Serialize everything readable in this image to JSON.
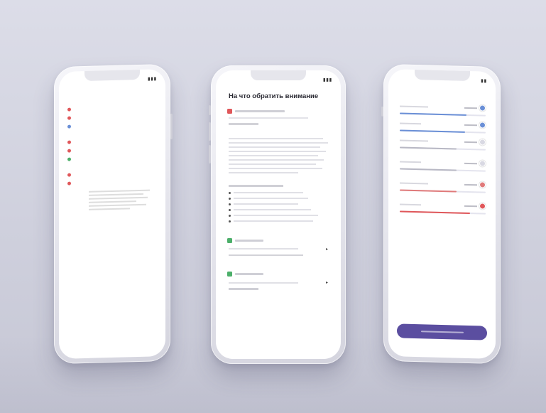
{
  "colors": {
    "background": "#d3d4e0",
    "accent_purple": "#5b4ea0",
    "red": "#e0575a",
    "green": "#4caf6a",
    "blue": "#6a8fd6"
  },
  "left_phone": {
    "status_time": "",
    "title": "",
    "sections": [
      {
        "heading": "",
        "rows": [
          {
            "color": "#e0575a",
            "tag": "",
            "text": ""
          },
          {
            "color": "#e0575a",
            "tag": "",
            "text": ""
          },
          {
            "color": "#6a8fd6",
            "tag": "",
            "text": ""
          }
        ]
      },
      {
        "heading": "",
        "rows": [
          {
            "color": "#e0575a",
            "tag": "",
            "text": ""
          },
          {
            "color": "#e0575a",
            "tag": "",
            "text": ""
          },
          {
            "color": "#4caf6a",
            "tag": "",
            "text": ""
          }
        ]
      },
      {
        "heading": "",
        "rows": [
          {
            "color": "#e0575a",
            "tag": "",
            "text": ""
          },
          {
            "color": "#e0575a",
            "tag": "",
            "text": ""
          }
        ]
      }
    ]
  },
  "middle_phone": {
    "status_time": "",
    "title": "На что обратить внимание",
    "chips": [
      {
        "color": "#e0575a"
      },
      {
        "color": "#4caf6a"
      },
      {
        "color": "#4caf6a"
      }
    ]
  },
  "right_phone": {
    "status_time": "",
    "title": "",
    "sliders": [
      {
        "color": "#6a8fd6",
        "level": 0.78
      },
      {
        "color": "#6a8fd6",
        "level": 0.76
      },
      {
        "color": "#d9d9e3",
        "level": 0.66
      },
      {
        "color": "#d9d9e3",
        "level": 0.66
      },
      {
        "color": "#e07a7a",
        "level": 0.66
      },
      {
        "color": "#e0575a",
        "level": 0.82
      }
    ],
    "button_label": ""
  }
}
